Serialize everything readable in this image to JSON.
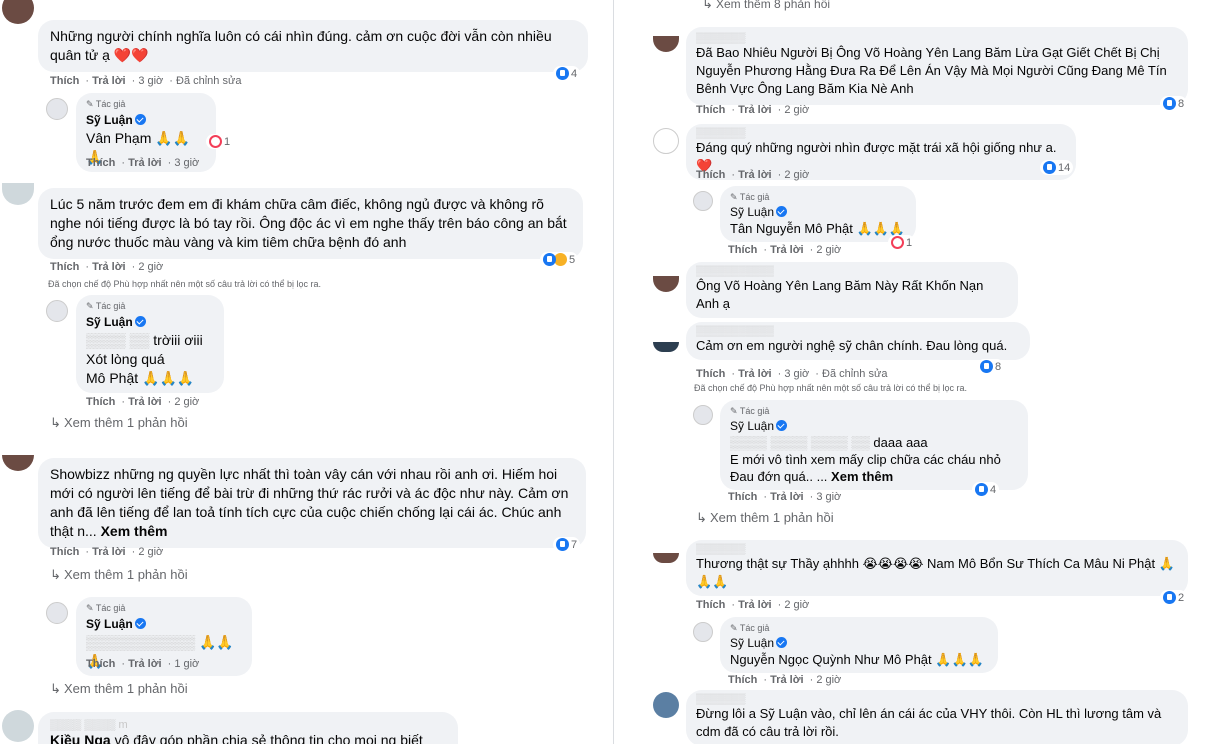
{
  "left": {
    "c1": {
      "text": "Những người chính nghĩa luôn có cái nhìn đúng. cảm ơn cuộc đời vẫn còn nhiều quân tử ạ ❤️❤️",
      "like": "Thích",
      "reply": "Trả lời",
      "time": "3 giờ",
      "edited": "Đã chỉnh sửa",
      "reactions": "4"
    },
    "r1": {
      "tag": "Tác giả",
      "author": "Sỹ Luận",
      "text": "Vân Phạm 🙏🙏🙏",
      "like": "Thích",
      "reply": "Trả lời",
      "time": "3 giờ",
      "reactions": "1"
    },
    "c2": {
      "text": "Lúc 5 năm trước đem em đi khám chữa câm điếc, không ngủ được và không rõ nghe nói tiếng được là bó tay rồi. Ông độc ác vì em nghe thấy trên báo công an bắt ổng nước thuốc màu vàng và kim tiêm chữa bệnh đó anh",
      "like": "Thích",
      "reply": "Trả lời",
      "time": "2 giờ",
      "reactions": "5",
      "filter": "Đã chọn chế độ Phù hợp nhất nên một số câu trả lời có thể bị lọc ra."
    },
    "r2": {
      "tag": "Tác giả",
      "author": "Sỹ Luận",
      "line1": "trờiii ơiii",
      "line2": "Xót lòng quá",
      "line3": "Mô Phật 🙏🙏🙏",
      "like": "Thích",
      "reply": "Trả lời",
      "time": "2 giờ"
    },
    "more1": "Xem thêm 1 phản hồi",
    "c3": {
      "text": "Showbizz những ng quyền lực nhất thì toàn vây cán với nhau rồi anh ơi. Hiếm hoi mới có người lên tiếng để bài trừ đi những thứ rác rưởi và ác độc như này. Cảm ơn anh đã lên tiếng để lan toả tính tích cực của cuộc chiến chống lại cái ác. Chúc anh thật n...",
      "see_more": "Xem thêm",
      "like": "Thích",
      "reply": "Trả lời",
      "time": "2 giờ",
      "reactions": "7"
    },
    "more2": "Xem thêm 1 phản hồi",
    "r3": {
      "tag": "Tác giả",
      "author": "Sỹ Luận",
      "text": "🙏🙏🙏",
      "like": "Thích",
      "reply": "Trả lời",
      "time": "1 giờ"
    },
    "more3": "Xem thêm 1 phản hồi",
    "c4": {
      "name": "Kiều Nga",
      "text": "vô đây góp phần chia sẻ thông tin cho mọi ng biết nhé"
    }
  },
  "right": {
    "top_more": "Xem thêm 8 phản hồi",
    "c1": {
      "text": "Đã Bao Nhiêu Người Bị Ông Võ Hoàng Yên Lang Băm Lừa Gạt Giết Chết Bị Chị Nguyễn Phương Hằng Đưa Ra Để Lên Án Vậy Mà Mọi Người Cũng Đang Mê Tín Bênh Vực Ông Lang Băm Kia Nè Anh",
      "like": "Thích",
      "reply": "Trả lời",
      "time": "2 giờ",
      "reactions": "8"
    },
    "c2": {
      "text": "Đáng quý những người nhìn được mặt trái xã hội giống như a.❤️",
      "like": "Thích",
      "reply": "Trả lời",
      "time": "2 giờ",
      "reactions": "14"
    },
    "r1": {
      "tag": "Tác giả",
      "author": "Sỹ Luận",
      "text": "Tân Nguyễn Mô Phật 🙏🙏🙏",
      "like": "Thích",
      "reply": "Trả lời",
      "time": "2 giờ",
      "reactions": "1"
    },
    "c3": {
      "text": "Ông Võ Hoàng Yên Lang Băm Này Rất Khốn Nạn Anh ạ"
    },
    "c4": {
      "text": "Cảm ơn em người nghệ sỹ chân chính. Đau lòng quá.",
      "like": "Thích",
      "reply": "Trả lời",
      "time": "3 giờ",
      "edited": "Đã chỉnh sửa",
      "reactions": "8",
      "filter": "Đã chọn chế độ Phù hợp nhất nên một số câu trả lời có thể bị lọc ra."
    },
    "r2": {
      "tag": "Tác giả",
      "author": "Sỹ Luận",
      "line1": "daaa aaa",
      "line2": "E mới vô tình xem mấy clip chữa các cháu nhỏ",
      "line3": "Đau đớn quá.. ...",
      "see_more": "Xem thêm",
      "like": "Thích",
      "reply": "Trả lời",
      "time": "3 giờ",
      "reactions": "4"
    },
    "more1": "Xem thêm 1 phản hồi",
    "c5": {
      "text": "Thương thật sự Thầy ạhhhh 😭😭😭😭 Nam Mô Bổn Sư Thích Ca Mâu Ni Phật 🙏🙏🙏",
      "like": "Thích",
      "reply": "Trả lời",
      "time": "2 giờ",
      "reactions": "2"
    },
    "r3": {
      "tag": "Tác giả",
      "author": "Sỹ Luận",
      "text": "Nguyễn Ngọc Quỳnh Như Mô Phật 🙏🙏🙏",
      "like": "Thích",
      "reply": "Trả lời",
      "time": "2 giờ"
    },
    "c6": {
      "text": "Đừng lôi a Sỹ Luận vào, chỉ lên án cái ác của VHY thôi. Còn HL thì lương tâm và cdm đã có câu trả lời rồi."
    }
  },
  "colors": {
    "accent": "#1877f2",
    "bubble": "#f0f2f5",
    "meta": "#65676b",
    "heart": "#f33e58"
  }
}
